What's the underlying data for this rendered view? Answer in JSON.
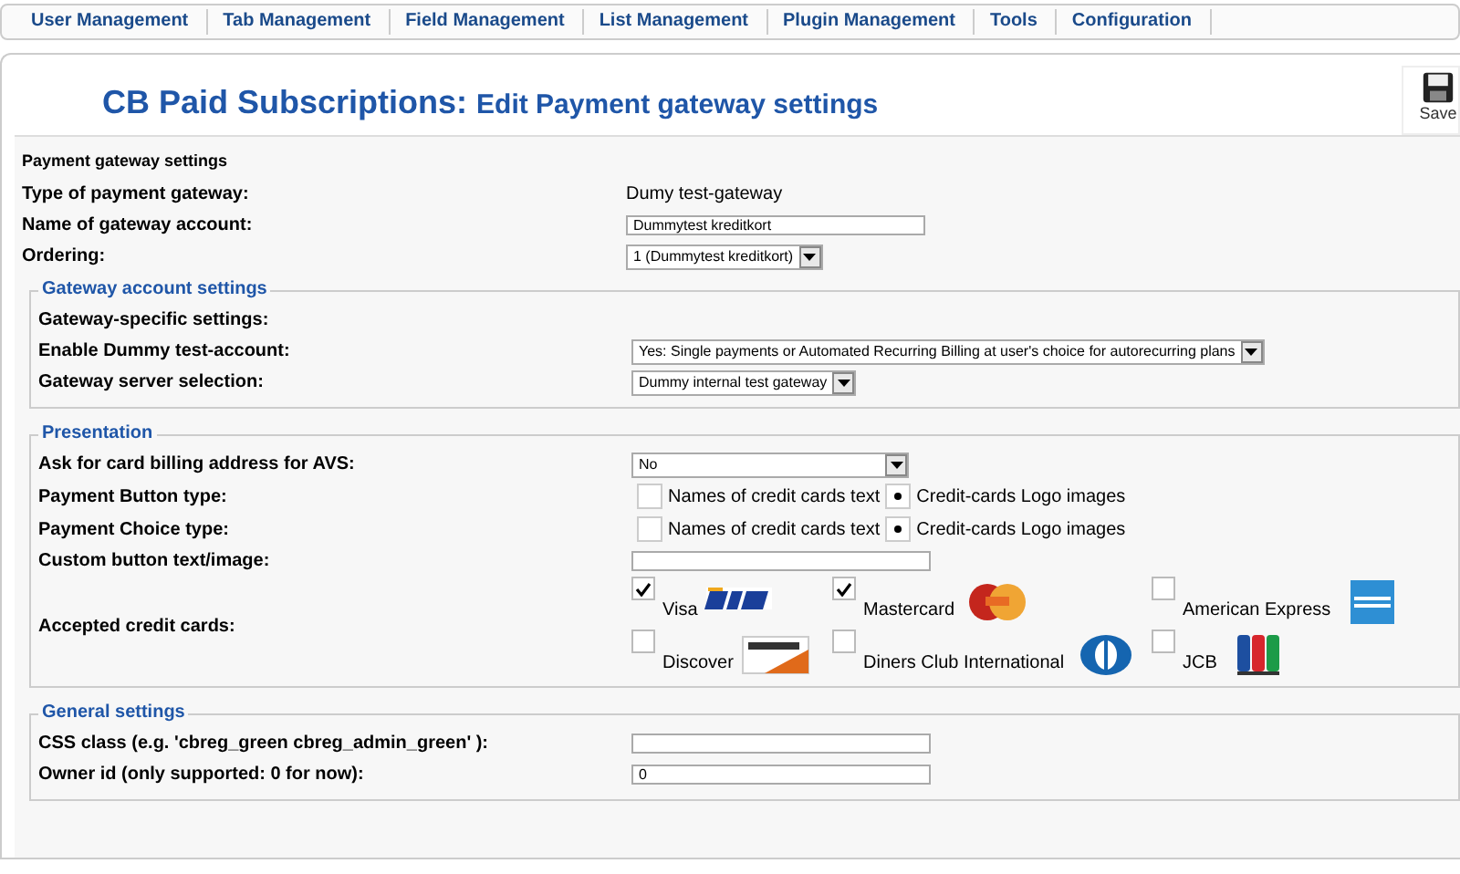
{
  "menu": [
    {
      "label": "User Management"
    },
    {
      "label": "Tab Management"
    },
    {
      "label": "Field Management"
    },
    {
      "label": "List Management"
    },
    {
      "label": "Plugin Management"
    },
    {
      "label": "Tools"
    },
    {
      "label": "Configuration"
    }
  ],
  "header": {
    "title_main": "CB Paid Subscriptions:",
    "title_sub": "Edit Payment gateway settings",
    "save": "Save"
  },
  "section": {
    "title": "Payment gateway settings",
    "rows": [
      {
        "kind": "text",
        "label": "Type of payment gateway:",
        "value": "Dumy test-gateway"
      },
      {
        "kind": "input",
        "label": "Name of gateway account:",
        "value": "Dummytest kreditkort"
      },
      {
        "kind": "select",
        "label": "Ordering:",
        "value": "1 (Dummytest kreditkort)"
      }
    ]
  },
  "fieldsets": [
    {
      "legend": "Gateway account settings",
      "rows": [
        {
          "kind": "none",
          "label": "Gateway-specific settings:"
        },
        {
          "kind": "select",
          "label": "Enable Dummy test-account:",
          "value": "Yes: Single payments or Automated Recurring Billing at user's choice for autorecurring plans"
        },
        {
          "kind": "select",
          "label": "Gateway server selection:",
          "value": "Dummy internal test gateway"
        }
      ]
    },
    {
      "legend": "Presentation",
      "rows": [
        {
          "kind": "select",
          "label": "Ask for card billing address for AVS:",
          "value": "No",
          "wide": true
        },
        {
          "kind": "radio",
          "label": "Payment Button type:",
          "options": [
            {
              "label": "Names of credit cards text",
              "selected": false
            },
            {
              "label": "Credit-cards Logo images",
              "selected": true
            }
          ]
        },
        {
          "kind": "radio",
          "label": "Payment Choice type:",
          "options": [
            {
              "label": "Names of credit cards text",
              "selected": false
            },
            {
              "label": "Credit-cards Logo images",
              "selected": true
            }
          ]
        },
        {
          "kind": "input",
          "label": "Custom button text/image:"
        },
        {
          "kind": "cards",
          "label": "Accepted credit cards:",
          "cards": [
            {
              "label": "Visa",
              "checked": true,
              "kind": "visa"
            },
            {
              "label": "Mastercard",
              "checked": true,
              "kind": "mastercard"
            },
            {
              "label": "American Express",
              "checked": false,
              "kind": "amex"
            },
            {
              "label": "Discover",
              "checked": false,
              "kind": "discover"
            },
            {
              "label": "Diners Club International",
              "checked": false,
              "kind": "diners"
            },
            {
              "label": "JCB",
              "checked": false,
              "kind": "jcb"
            }
          ]
        }
      ]
    },
    {
      "legend": "General settings",
      "rows": [
        {
          "kind": "input",
          "label": "CSS class (e.g. 'cbreg_green cbreg_admin_green' ):"
        },
        {
          "kind": "input",
          "label": "Owner id (only supported: 0 for now):",
          "value": "0"
        }
      ]
    }
  ]
}
